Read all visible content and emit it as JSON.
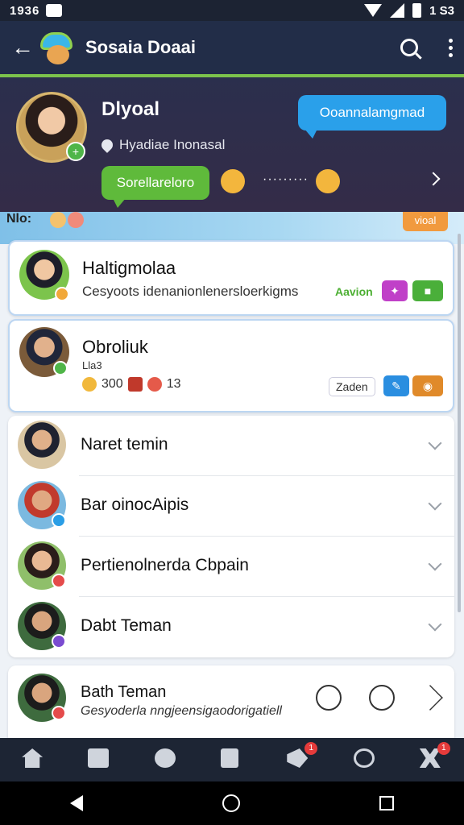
{
  "status_bar": {
    "time": "1936",
    "battery": "1 S3"
  },
  "app_bar": {
    "back_icon": "arrow-left-icon",
    "title": "Sosaia Doaai",
    "search_icon": "search-icon",
    "more_icon": "more-vertical-icon"
  },
  "colors": {
    "primary": "#222d48",
    "accent_green": "#5fba3b",
    "accent_blue": "#2aa0ea",
    "accent_orange": "#f19a3e"
  },
  "profile": {
    "name": "Dlyoal",
    "subtitle": "Hyadiae Inonasal",
    "bubble_blue": "Ooannalamgmad",
    "bubble_green": "Sorellareloro",
    "typing": "·········"
  },
  "banner": {
    "label": "Nlo:",
    "tag": "vioal"
  },
  "cards": [
    {
      "title": "Haltigmolaa",
      "subtitle": "Cesyoots idenanionlenersloerkigms",
      "label": "Aavion"
    },
    {
      "title": "Obroliuk",
      "subtitle": "Lla3",
      "stat_1": "300",
      "stat_2": "13",
      "label": "Zaden"
    }
  ],
  "list": [
    {
      "label": "Naret temin"
    },
    {
      "label": "Bar oinocAipis"
    },
    {
      "label": "Pertienolnerda Cbpain"
    },
    {
      "label": "Dabt Teman"
    }
  ],
  "card_3": {
    "title": "Bath Teman",
    "subtitle": "Gesyoderla nngjeensigaodorigatiell"
  },
  "bottom_nav": {
    "items": [
      "home-icon",
      "gallery-icon",
      "emoji-icon",
      "clipboard-icon",
      "megaphone-icon",
      "search-icon",
      "network-icon"
    ],
    "badge_1": "1",
    "badge_2": "1"
  }
}
